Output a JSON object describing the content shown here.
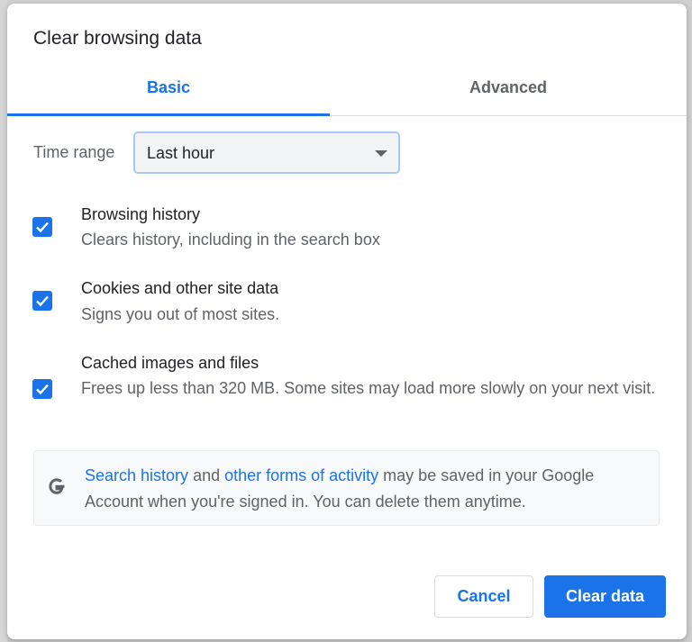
{
  "dialog": {
    "title": "Clear browsing data"
  },
  "tabs": [
    {
      "label": "Basic",
      "selected": true
    },
    {
      "label": "Advanced",
      "selected": false
    }
  ],
  "time_range": {
    "label": "Time range",
    "value": "Last hour"
  },
  "options": [
    {
      "title": "Browsing history",
      "description": "Clears history, including in the search box",
      "checked": true
    },
    {
      "title": "Cookies and other site data",
      "description": "Signs you out of most sites.",
      "checked": true
    },
    {
      "title": "Cached images and files",
      "description": "Frees up less than 320 MB. Some sites may load more slowly on your next visit.",
      "checked": true
    }
  ],
  "info": {
    "icon": "google-g-icon",
    "link1": "Search history",
    "text1": " and ",
    "link2": "other forms of activity",
    "text2": " may be saved in your Google Account when you're signed in. You can delete them anytime."
  },
  "buttons": {
    "cancel": "Cancel",
    "clear": "Clear data"
  },
  "colors": {
    "accent": "#1a73e8",
    "text": "#202124",
    "secondary_text": "#5f6368"
  }
}
